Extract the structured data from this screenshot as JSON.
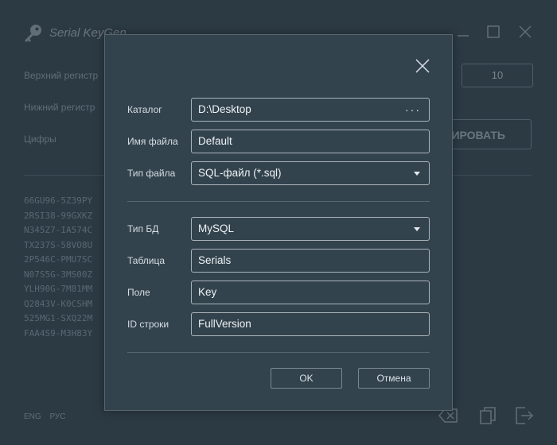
{
  "app": {
    "title": "Serial KeyGen",
    "labels": {
      "upper": "Верхний регистр",
      "lower": "Нижний регистр",
      "digits": "Цифры"
    },
    "count_value": "10",
    "generate_label": "РИРОВАТЬ",
    "serials": [
      "66GU96-5Z39PY",
      "2RSI38-99GXKZ",
      "N345Z7-IA574C",
      "TX237S-58VO8U",
      "2P546C-PMU7SC",
      "N07S5G-3MS00Z",
      "YLH90G-7M81MM",
      "Q2843V-K0CSHM",
      "525MG1-SXQ22M",
      "FAA4S9-M3H83Y"
    ],
    "lang": {
      "eng": "ENG",
      "rus": "РУС"
    }
  },
  "dialog": {
    "catalog": {
      "label": "Каталог",
      "value": "D:\\Desktop",
      "browse": "···"
    },
    "filename": {
      "label": "Имя файла",
      "value": "Default"
    },
    "filetype": {
      "label": "Тип файла",
      "value": "SQL-файл (*.sql)"
    },
    "dbtype": {
      "label": "Тип БД",
      "value": "MySQL"
    },
    "table": {
      "label": "Таблица",
      "value": "Serials"
    },
    "field": {
      "label": "Поле",
      "value": "Key"
    },
    "rowid": {
      "label": "ID строки",
      "value": "FullVersion"
    },
    "ok_label": "OK",
    "cancel_label": "Отмена"
  },
  "colors": {
    "background": "#2c3a44",
    "dialog": "#33434e",
    "border": "#a9b3b9"
  }
}
